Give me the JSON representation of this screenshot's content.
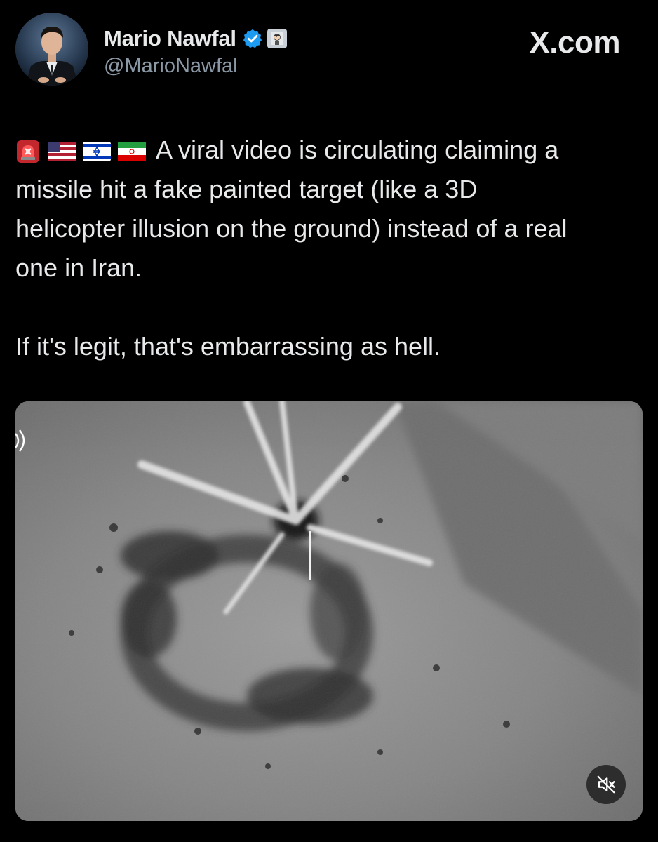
{
  "author": {
    "display_name": "Mario Nawfal",
    "handle": "@MarioNawfal",
    "verified_icon": "verified-badge-icon",
    "affiliate_icon": "affiliate-badge-icon",
    "verified_color": "#1d9bf0"
  },
  "brand": {
    "label": "X.com"
  },
  "tweet": {
    "emojis": [
      "rotating-light-icon",
      "us-flag-icon",
      "israel-flag-icon",
      "iran-flag-icon"
    ],
    "paragraph1_line1": "A viral video is circulating claiming a",
    "paragraph1_line2": "missile hit a fake painted target (like a 3D",
    "paragraph1_line3": "helicopter illusion on the ground) instead of a real",
    "paragraph1_line4": "one in Iran.",
    "paragraph2": "If it's legit, that's embarrassing as hell."
  },
  "media": {
    "type": "video",
    "description_icon": "video-thumbnail",
    "mute_icon": "muted-speaker-icon",
    "audio_icon": "sound-wave-icon"
  },
  "colors": {
    "background": "#000000",
    "text": "#e7e9ea",
    "muted_text": "#8b98a5"
  }
}
